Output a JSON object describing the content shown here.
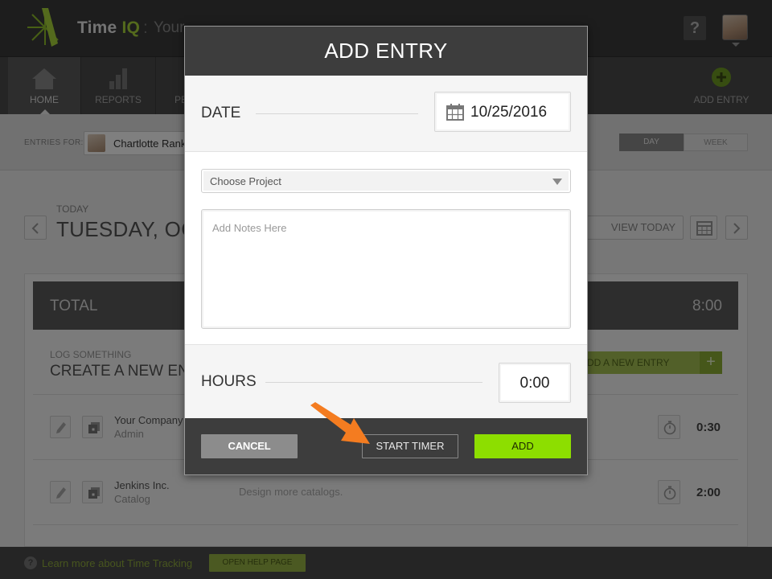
{
  "app": {
    "brand_main": "Time",
    "brand_accent": "IQ",
    "brand_sep": ":",
    "brand_sub": "Your",
    "help_label": "?"
  },
  "nav": {
    "home": "HOME",
    "reports": "REPORTS",
    "people": "PE",
    "add_entry": "ADD ENTRY"
  },
  "entries": {
    "label": "ENTRIES FOR:",
    "user": "Chartlotte Rank",
    "day": "DAY",
    "week": "WEEK"
  },
  "day_header": {
    "today_label": "TODAY",
    "date": "TUESDAY, OC",
    "view_today": "VIEW TODAY"
  },
  "summary": {
    "total_label": "TOTAL",
    "total_value": "8:00",
    "log_small": "LOG SOMETHING",
    "log_big": "CREATE A NEW EN",
    "add_new_entry": "DD A NEW ENTRY",
    "add_plus": "+"
  },
  "rows": [
    {
      "client": "Your Company",
      "project": "Admin",
      "notes": "",
      "hours": "0:30"
    },
    {
      "client": "Jenkins Inc.",
      "project": "Catalog",
      "notes": "Design more catalogs.",
      "hours": "2:00"
    }
  ],
  "footer": {
    "help_icon": "?",
    "text": "Learn more about Time Tracking",
    "button": "OPEN HELP PAGE"
  },
  "modal": {
    "title": "ADD ENTRY",
    "date_label": "DATE",
    "date_value": "10/25/2016",
    "project_placeholder": "Choose Project",
    "notes_placeholder": "Add Notes Here",
    "hours_label": "HOURS",
    "hours_value": "0:00",
    "cancel": "CANCEL",
    "start_timer": "START TIMER",
    "add": "ADD"
  },
  "colors": {
    "accent_green": "#8dde00",
    "pointer_orange": "#f47c20",
    "header_dark": "#3d3d3d"
  },
  "icons": [
    "logo-icon",
    "home-icon",
    "reports-icon",
    "add-circle-icon",
    "calendar-icon",
    "chevron-left-icon",
    "chevron-right-icon",
    "pencil-icon",
    "duplicate-icon",
    "stopwatch-icon",
    "pointer-arrow-icon",
    "dropdown-caret-icon"
  ]
}
